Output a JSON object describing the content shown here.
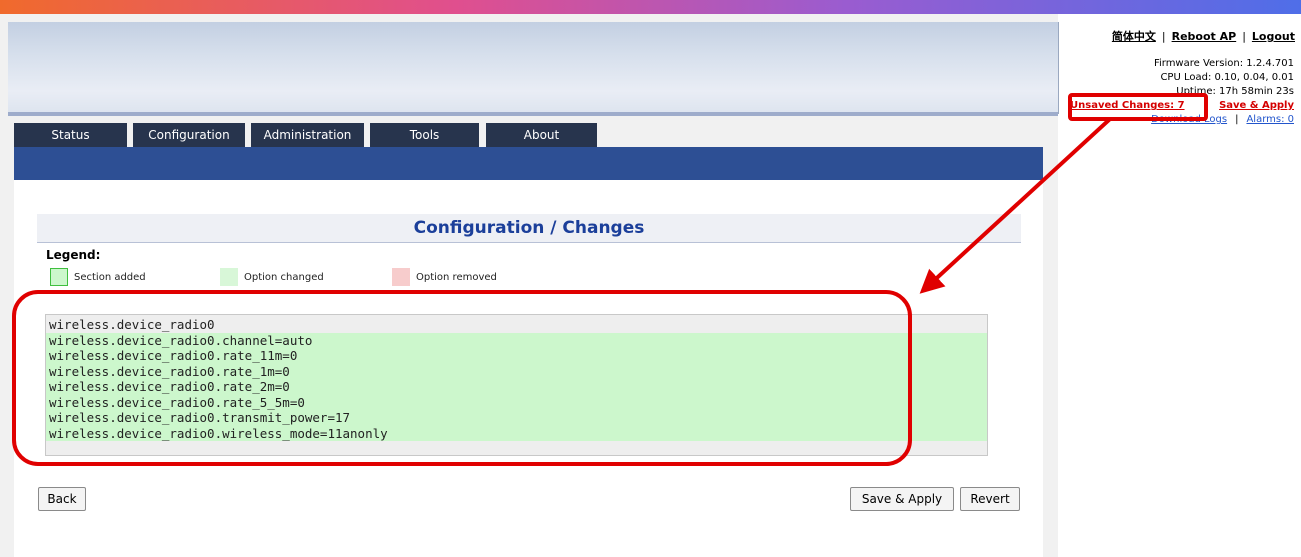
{
  "header": {
    "language_link": "简体中文",
    "reboot_link": "Reboot AP",
    "logout_link": "Logout",
    "firmware": "Firmware Version: 1.2.4.701",
    "cpu_load": "CPU Load: 0.10, 0.04, 0.01",
    "uptime": "Uptime: 17h 58min 23s",
    "unsaved_changes": "Unsaved Changes: 7",
    "save_apply_link": "Save & Apply",
    "download_logs": "Download Logs",
    "alarms": "Alarms: 0",
    "separator": "|"
  },
  "tabs": [
    {
      "label": "Status"
    },
    {
      "label": "Configuration"
    },
    {
      "label": "Administration"
    },
    {
      "label": "Tools"
    },
    {
      "label": "About"
    }
  ],
  "page": {
    "title": "Configuration / Changes",
    "legend_title": "Legend:",
    "legend": [
      {
        "label": "Section added",
        "color": "#ccf7cc",
        "border": "#3fbf3f"
      },
      {
        "label": "Option changed",
        "color": "#d8f7d8",
        "border": "#d8f7d8"
      },
      {
        "label": "Option removed",
        "color": "#f7cccc",
        "border": "#f7cccc"
      }
    ],
    "changes": [
      {
        "text": "wireless.device_radio0",
        "type": "section"
      },
      {
        "text": "wireless.device_radio0.channel=auto",
        "type": "changed"
      },
      {
        "text": "wireless.device_radio0.rate_11m=0",
        "type": "changed"
      },
      {
        "text": "wireless.device_radio0.rate_1m=0",
        "type": "changed"
      },
      {
        "text": "wireless.device_radio0.rate_2m=0",
        "type": "changed"
      },
      {
        "text": "wireless.device_radio0.rate_5_5m=0",
        "type": "changed"
      },
      {
        "text": "wireless.device_radio0.transmit_power=17",
        "type": "changed"
      },
      {
        "text": "wireless.device_radio0.wireless_mode=11anonly",
        "type": "changed"
      }
    ],
    "buttons": {
      "back": "Back",
      "save_apply": "Save & Apply",
      "revert": "Revert"
    }
  },
  "colors": {
    "nav_dark": "#27344d",
    "nav_blue": "#2d4f94",
    "title_blue": "#1b3f9a",
    "annotation_red": "#e00000",
    "changed_green": "#ccf7cc"
  }
}
